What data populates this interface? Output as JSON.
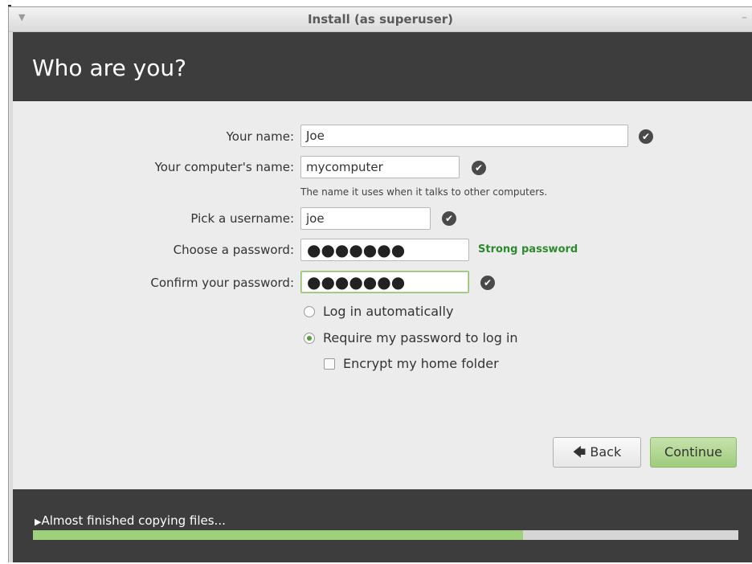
{
  "window": {
    "title": "Install (as superuser)",
    "menu_icon": "chevron-down-icon",
    "minimize_glyph": "–"
  },
  "header": {
    "title": "Who are you?"
  },
  "form": {
    "name_label": "Your name:",
    "name_value": "Joe",
    "computer_label": "Your computer's name:",
    "computer_value": "mycomputer",
    "computer_hint": "The name it uses when it talks to other computers.",
    "username_label": "Pick a username:",
    "username_value": "joe",
    "password_label": "Choose a password:",
    "password_value": "●●●●●●●",
    "password_strength": "Strong password",
    "confirm_label": "Confirm your password:",
    "confirm_value": "●●●●●●●",
    "check_glyph": "✔"
  },
  "options": {
    "auto_login_label": "Log in automatically",
    "auto_login_selected": false,
    "require_password_label": "Require my password to log in",
    "require_password_selected": true,
    "encrypt_label": "Encrypt my home folder",
    "encrypt_checked": false
  },
  "buttons": {
    "back_label": "Back",
    "back_arrow": "🡄",
    "continue_label": "Continue"
  },
  "footer": {
    "status_arrow": "▶",
    "status_text": "Almost finished copying files...",
    "progress": 0.695
  },
  "colors": {
    "header_bg": "#3d3d3d",
    "accent_green": "#9fd17c",
    "strong_text": "#2d8a2d"
  }
}
